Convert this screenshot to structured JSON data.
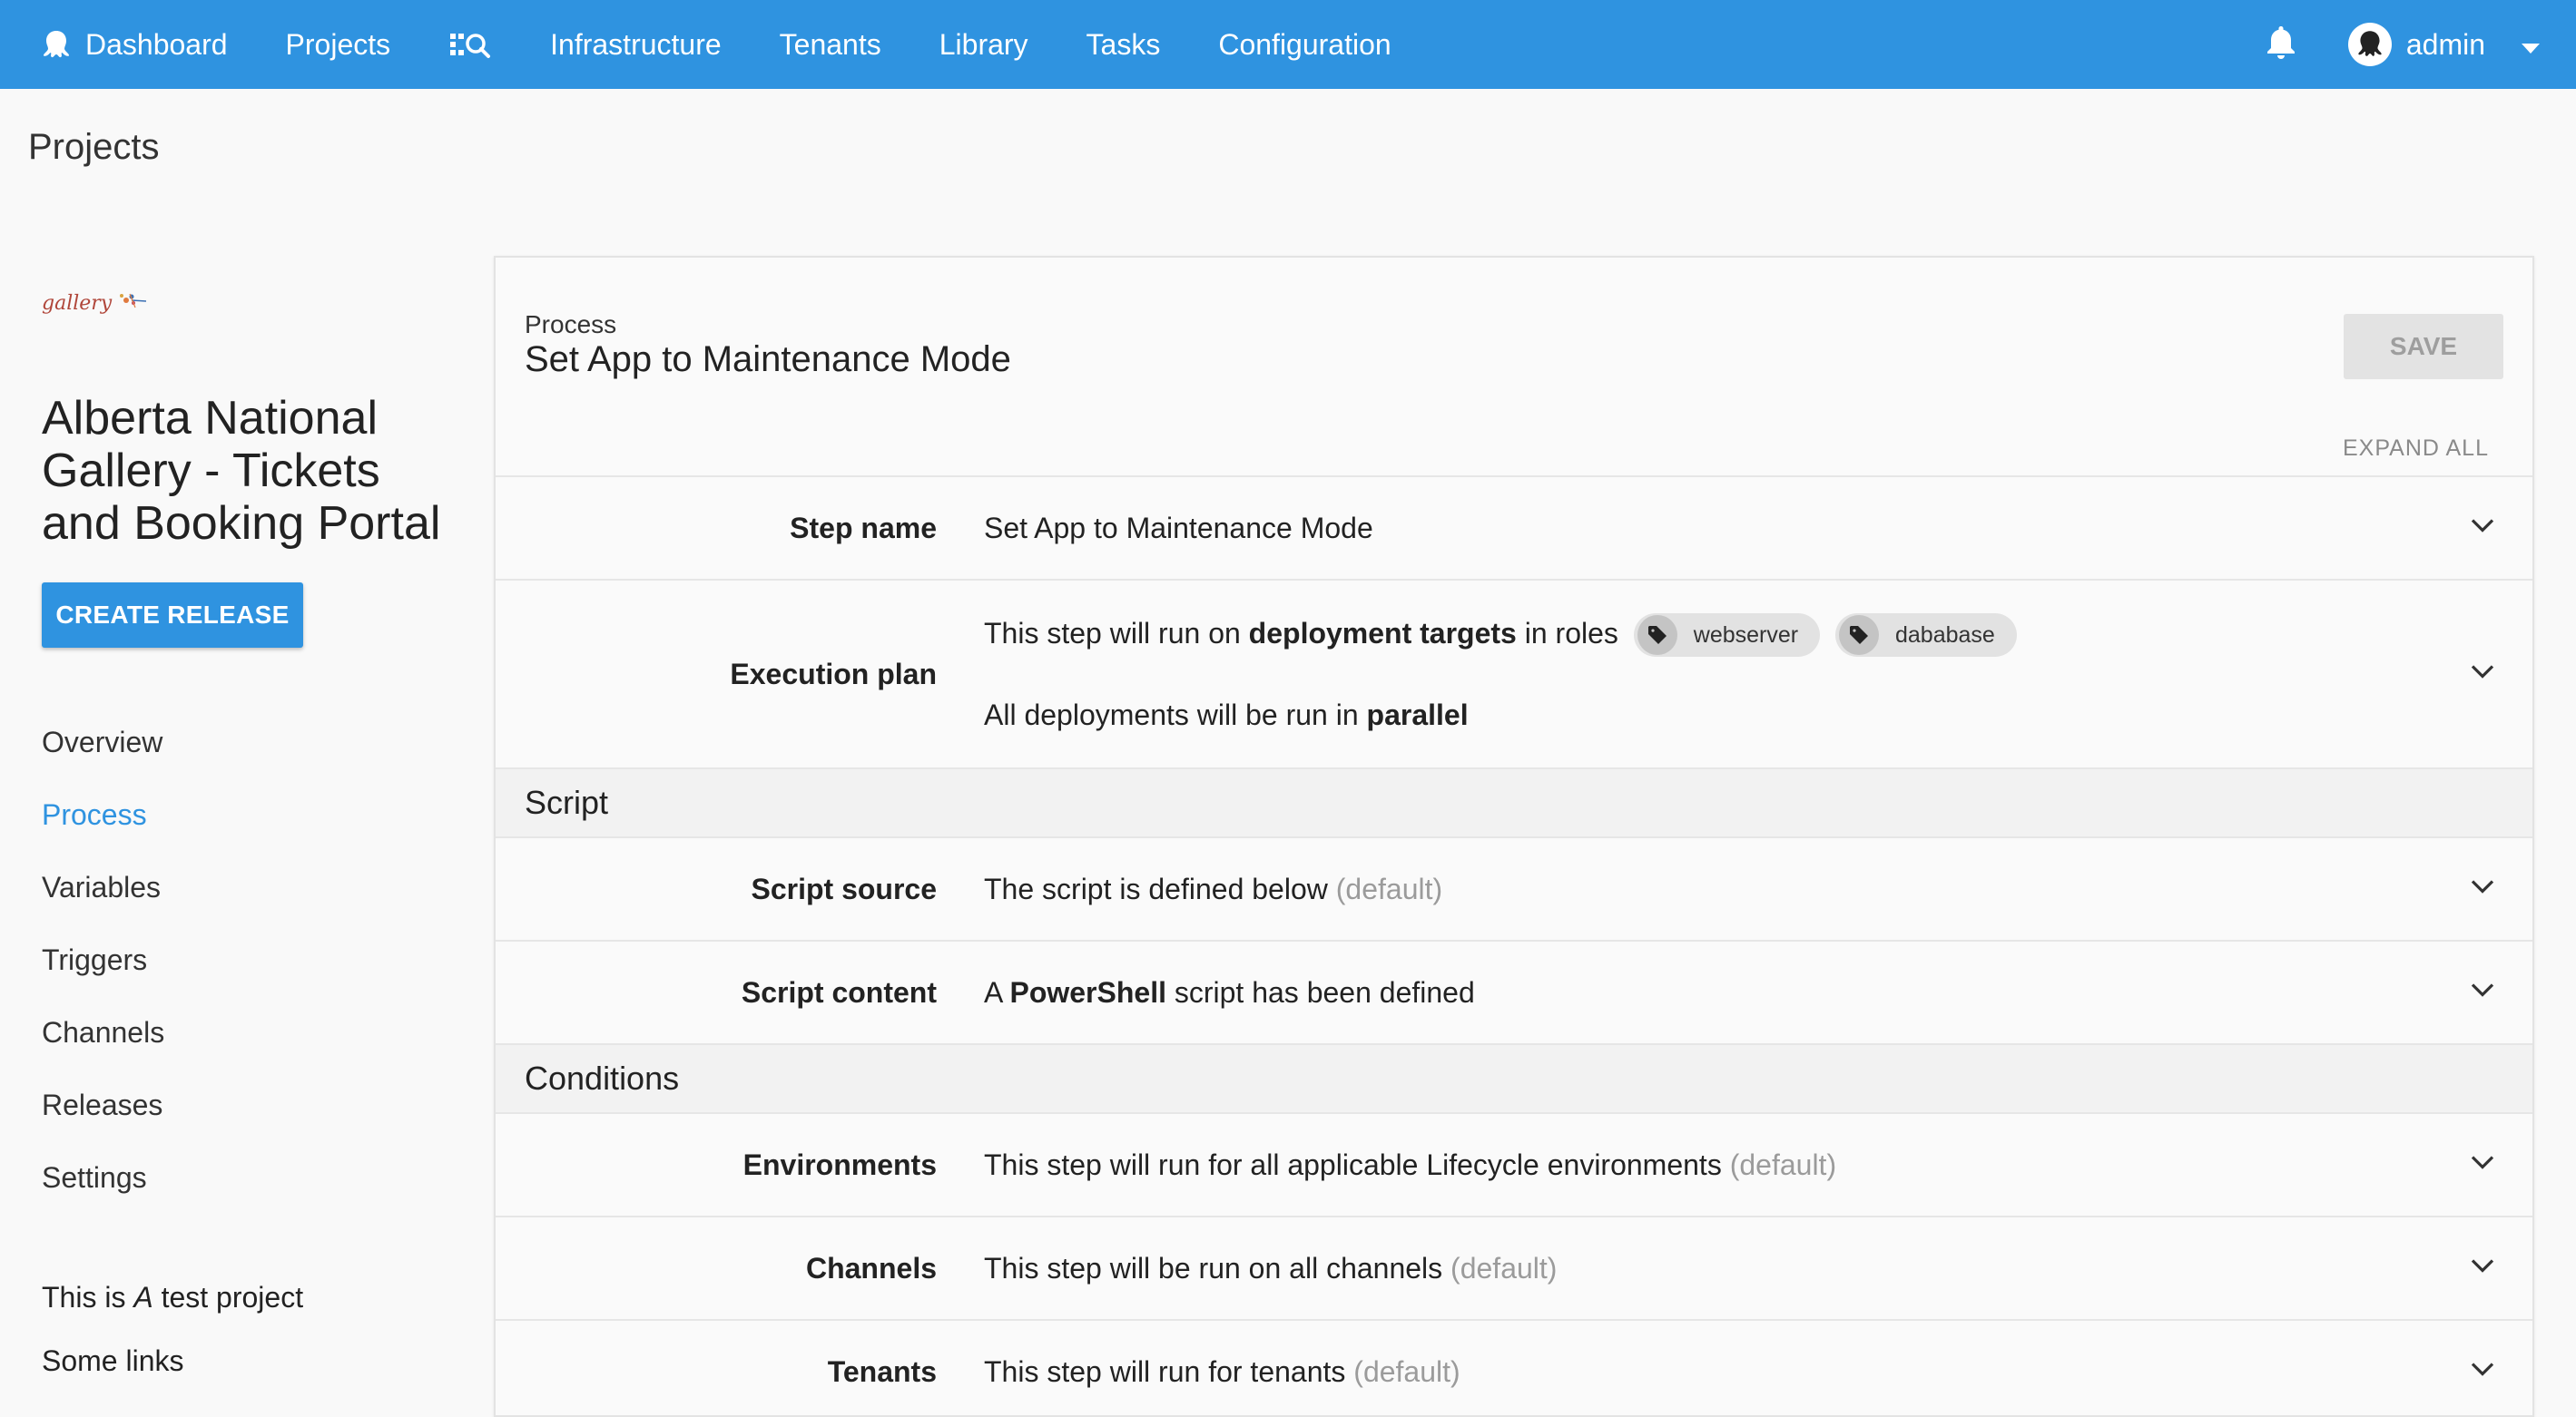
{
  "nav": {
    "dashboard": "Dashboard",
    "projects": "Projects",
    "search_icon": "search-icon",
    "infrastructure": "Infrastructure",
    "tenants": "Tenants",
    "library": "Library",
    "tasks": "Tasks",
    "configuration": "Configuration",
    "username": "admin"
  },
  "page_title": "Projects",
  "project": {
    "logo_text": "gallery",
    "name": "Alberta National Gallery - Tickets and Booking Portal",
    "create_release": "CREATE RELEASE",
    "menu": [
      "Overview",
      "Process",
      "Variables",
      "Triggers",
      "Channels",
      "Releases",
      "Settings"
    ],
    "active_menu": "Process",
    "desc_pre": "This is ",
    "desc_em": "A",
    "desc_post": " test project",
    "some_links": "Some links"
  },
  "panel": {
    "kicker": "Process",
    "title": "Set App to Maintenance Mode",
    "save": "SAVE",
    "expand_all": "EXPAND ALL"
  },
  "rows": {
    "step_name": {
      "label": "Step name",
      "value": "Set App to Maintenance Mode"
    },
    "execution_plan": {
      "label": "Execution plan",
      "line1_pre": "This step will run on ",
      "line1_bold": "deployment targets",
      "line1_post": " in roles",
      "roles": [
        "webserver",
        "dababase"
      ],
      "line2_pre": "All deployments will be run in ",
      "line2_bold": "parallel"
    },
    "section_script": "Script",
    "script_source": {
      "label": "Script source",
      "value": "The script is defined below",
      "hint": "(default)"
    },
    "script_content": {
      "label": "Script content",
      "pre": "A ",
      "bold": "PowerShell",
      "post": " script has been defined"
    },
    "section_conditions": "Conditions",
    "environments": {
      "label": "Environments",
      "value": "This step will run for all applicable Lifecycle environments",
      "hint": "(default)"
    },
    "channels": {
      "label": "Channels",
      "value": "This step will be run on all channels",
      "hint": "(default)"
    },
    "tenants": {
      "label": "Tenants",
      "value": "This step will run for tenants",
      "hint": "(default)"
    }
  },
  "colors": {
    "accent": "#2f93e0",
    "muted": "#9b9b9b",
    "chip": "#e2e2e2"
  }
}
